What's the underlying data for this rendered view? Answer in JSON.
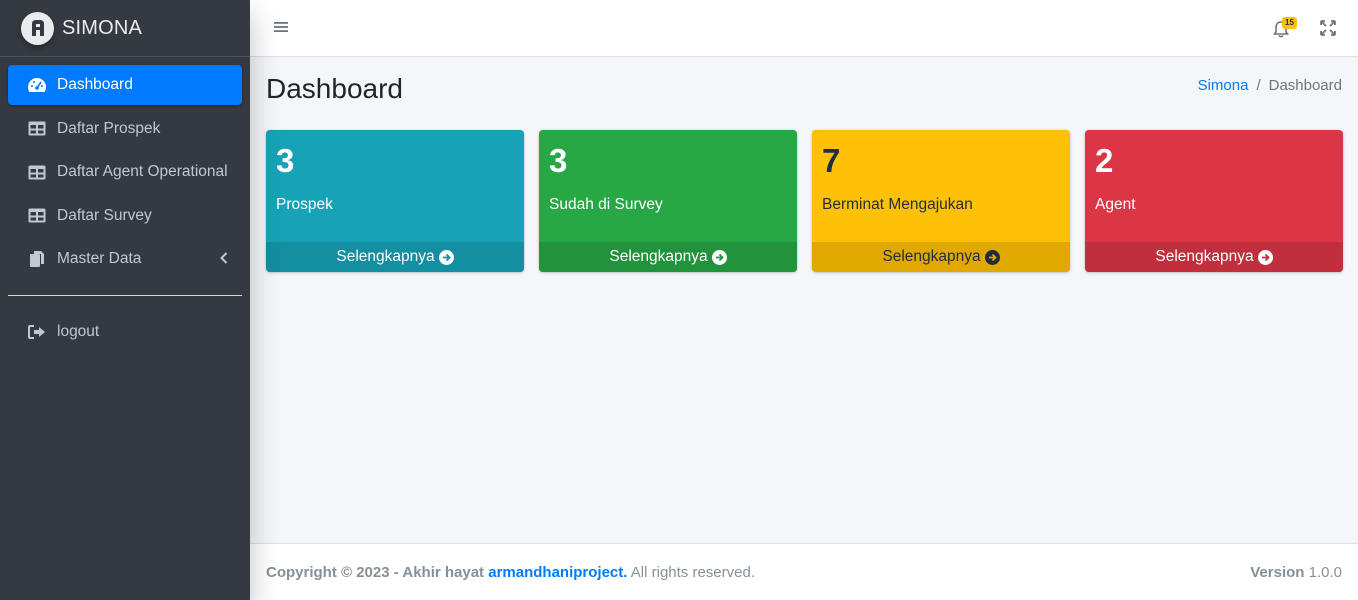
{
  "brand": {
    "name": "SIMONA"
  },
  "sidebar": {
    "items": [
      {
        "label": "Dashboard",
        "icon": "tachometer-icon",
        "active": true
      },
      {
        "label": "Daftar Prospek",
        "icon": "table-icon"
      },
      {
        "label": "Daftar Agent Operational",
        "icon": "table-icon"
      },
      {
        "label": "Daftar Survey",
        "icon": "table-icon"
      },
      {
        "label": "Master Data",
        "icon": "copy-icon",
        "has_submenu": true
      }
    ],
    "logout": {
      "label": "logout",
      "icon": "sign-out-icon"
    }
  },
  "navbar": {
    "notification_count": "15"
  },
  "header": {
    "title": "Dashboard"
  },
  "breadcrumb": {
    "root": "Simona",
    "separator": "/",
    "current": "Dashboard"
  },
  "stats": [
    {
      "value": "3",
      "label": "Prospek",
      "link": "Selengkapnya",
      "color": "#17a2b8"
    },
    {
      "value": "3",
      "label": "Sudah di Survey",
      "link": "Selengkapnya",
      "color": "#28a745"
    },
    {
      "value": "7",
      "label": "Berminat Mengajukan",
      "link": "Selengkapnya",
      "color": "#ffc107"
    },
    {
      "value": "2",
      "label": "Agent",
      "link": "Selengkapnya",
      "color": "#dc3545"
    }
  ],
  "footer": {
    "copyright": "Copyright © 2023 - Akhir hayat",
    "author": "armandhaniproject.",
    "rights": "All rights reserved.",
    "version_label": "Version",
    "version": "1.0.0"
  }
}
